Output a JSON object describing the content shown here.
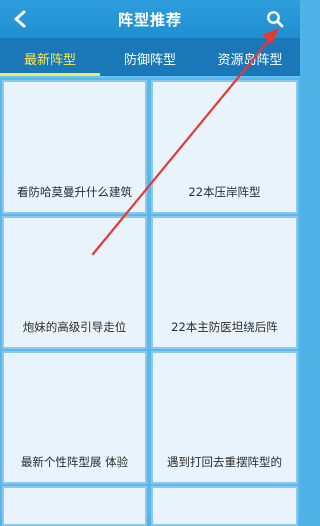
{
  "header": {
    "title": "阵型推荐",
    "back_icon": "chevron-left-icon",
    "search_icon": "search-icon"
  },
  "tabs": [
    {
      "label": "最新阵型",
      "active": true
    },
    {
      "label": "防御阵型",
      "active": false
    },
    {
      "label": "资源岛阵型",
      "active": false
    }
  ],
  "cards": [
    {
      "label": "看防哈莫曼升什么建筑"
    },
    {
      "label": "22本压岸阵型"
    },
    {
      "label": "炮妹的高级引导走位"
    },
    {
      "label": "22本主防医坦绕后阵"
    },
    {
      "label": "最新个性阵型展 体验"
    },
    {
      "label": "遇到打回去重摆阵型的"
    }
  ],
  "colors": {
    "header_bg": "#2196d8",
    "tab_bar_bg": "#1a78b8",
    "active_tab": "#ffe84a",
    "card_bg": "#e8f3fb",
    "annotation_arrow": "#e53935"
  }
}
